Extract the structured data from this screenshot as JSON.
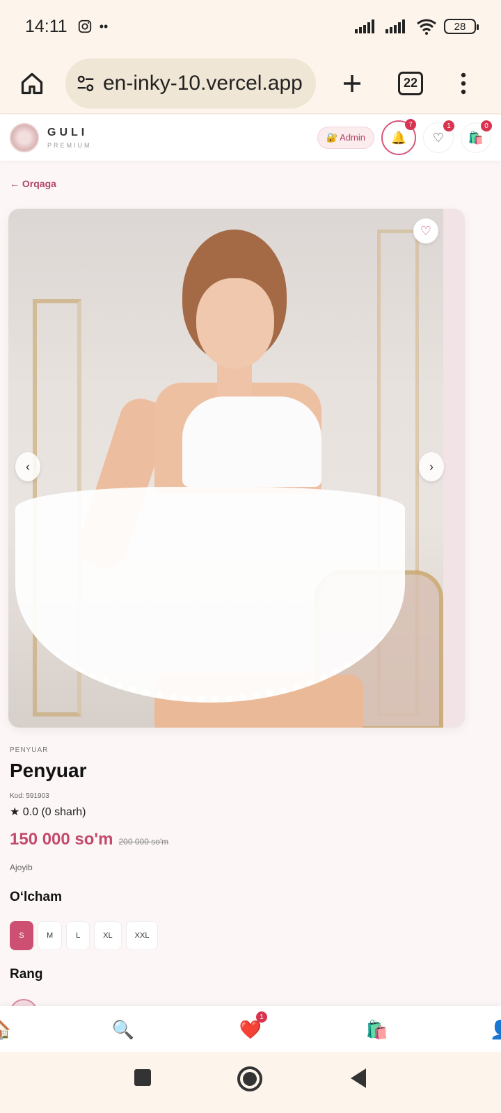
{
  "status_bar": {
    "time": "14:11",
    "battery": "28"
  },
  "browser": {
    "url": "en-inky-10.vercel.app",
    "tab_count": "22"
  },
  "header": {
    "brand_name": "GULI",
    "brand_sub": "PREMIUM",
    "admin_label": "🔐 Admin",
    "notifications_count": "7",
    "wishlist_count": "1",
    "cart_count": "0"
  },
  "back_label": "← Orqaga",
  "gallery": {
    "prev": "‹",
    "next": "›",
    "fav": "♡"
  },
  "product": {
    "category": "PENYUAR",
    "title": "Penyuar",
    "code": "Kod: 591903",
    "rating": "★ 0.0 (0 sharh)",
    "price": "150 000 so'm",
    "old_price": "200 000 so'm",
    "description": "Ajoyib",
    "size_heading": "O‘lcham",
    "sizes": [
      "S",
      "M",
      "L",
      "XL",
      "XXL"
    ],
    "selected_size": "S",
    "color_heading": "Rang"
  },
  "bottom_nav": {
    "favorites_badge": "1"
  },
  "colors": {
    "accent": "#cd4f72",
    "badge": "#d8334f",
    "browser_bg": "#fdf5ec"
  }
}
